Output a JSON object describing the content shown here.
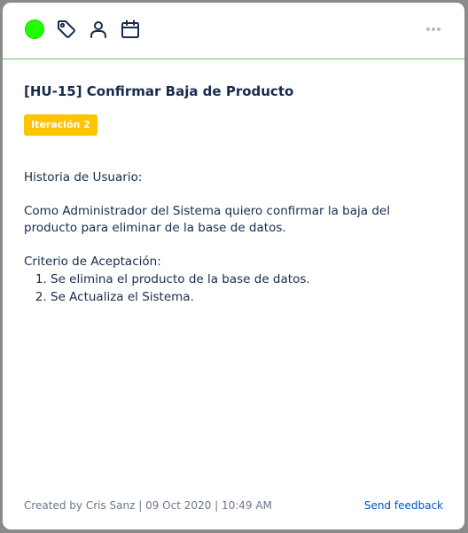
{
  "colors": {
    "status": "#21ff00",
    "divider": "#6cc16c",
    "badge_bg": "#ffc400",
    "link": "#0052cc"
  },
  "toolbar": {
    "icons": [
      "status-indicator",
      "tag-icon",
      "user-icon",
      "calendar-icon",
      "more-options-icon"
    ]
  },
  "issue": {
    "title": "[HU-15] Confirmar Baja de Producto",
    "badge": "Iteración 2"
  },
  "description": {
    "heading": "Historia de Usuario:",
    "story": "Como Administrador del Sistema quiero confirmar la baja del producto para eliminar de la base de datos.",
    "criteria_heading": "Criterio de Aceptación:",
    "criteria": [
      "Se elimina el producto de la base de datos.",
      "Se Actualiza el Sistema."
    ]
  },
  "footer": {
    "meta": "Created by Cris Sanz | 09 Oct 2020 | 10:49 AM",
    "feedback": "Send feedback"
  }
}
